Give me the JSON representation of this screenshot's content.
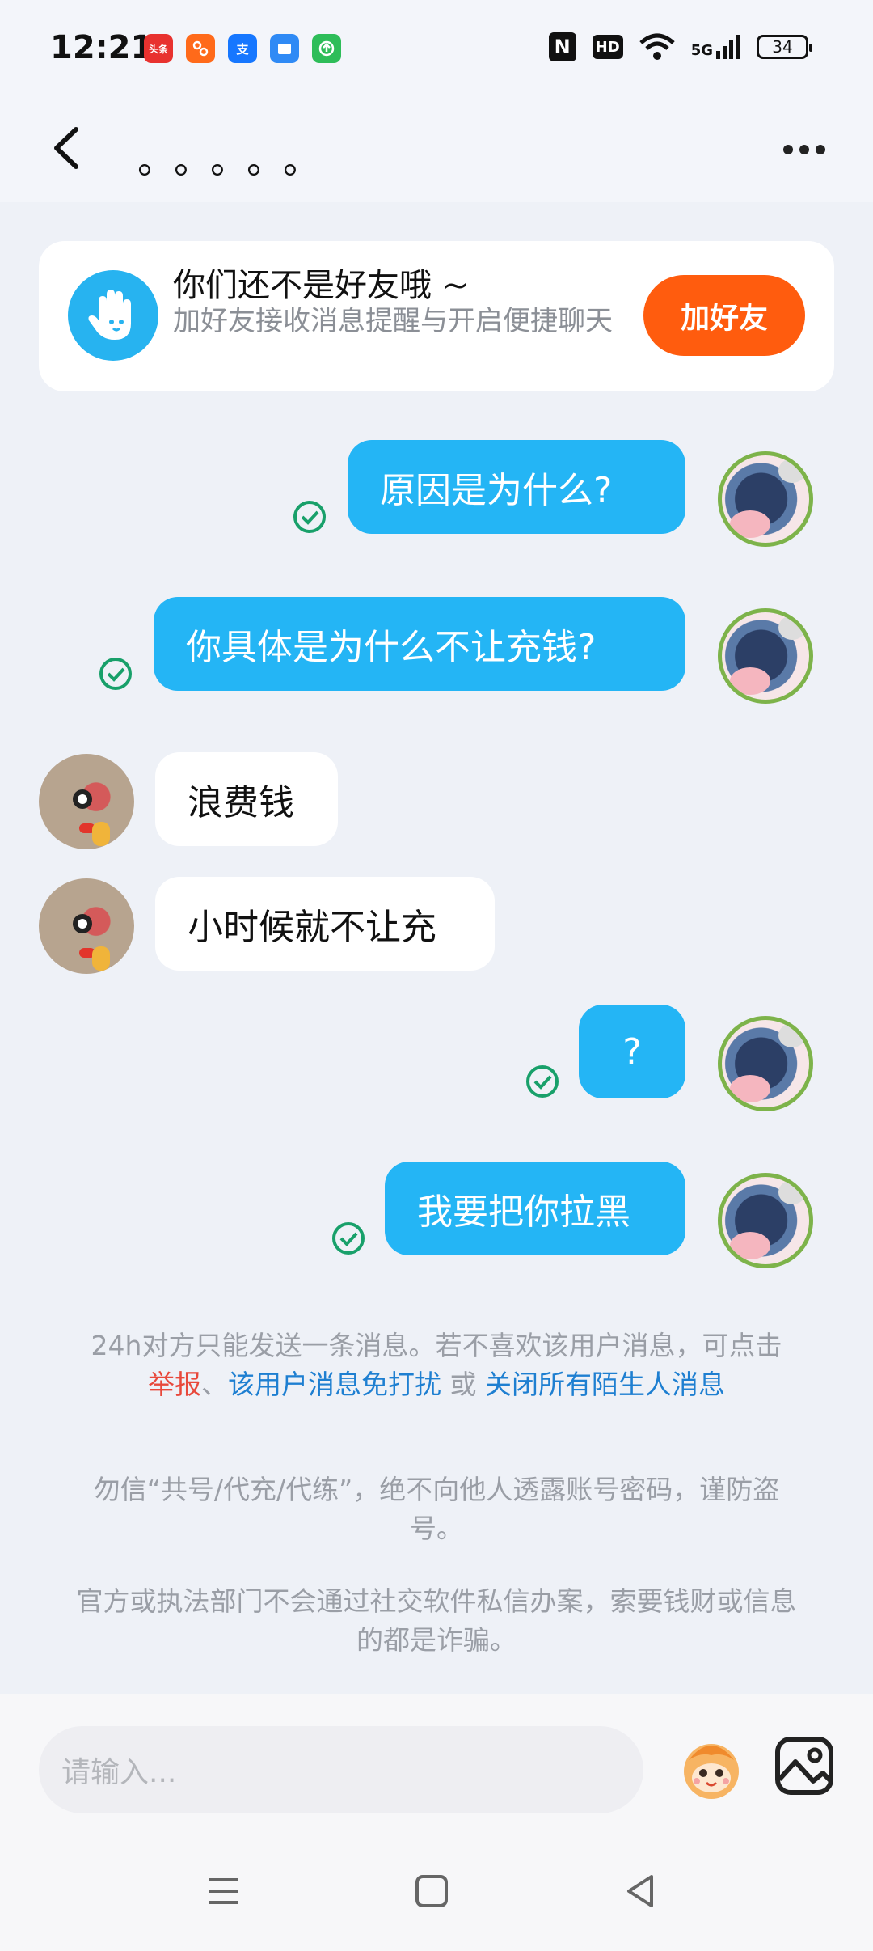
{
  "status_bar": {
    "time": "12:21",
    "apps": [
      {
        "name": "toutiao-icon",
        "label": "头条",
        "color": "#e8322f"
      },
      {
        "name": "app-orange-icon",
        "label": "",
        "color": "#ff6a1a"
      },
      {
        "name": "alipay-icon",
        "label": "支",
        "color": "#1677ff"
      },
      {
        "name": "files-icon",
        "label": "",
        "color": "#2f8af5"
      },
      {
        "name": "update-icon",
        "label": "",
        "color": "#2ebd59"
      }
    ],
    "nfc": "N",
    "hd": "HD",
    "network": "5G",
    "battery": "34"
  },
  "header": {
    "title": "。。。。。"
  },
  "friend_card": {
    "title": "你们还不是好友哦 ~",
    "subtitle": "加好友接收消息提醒与开启便捷聊天",
    "button": "加好友"
  },
  "messages": [
    {
      "from": "me",
      "text": "原因是为什么?"
    },
    {
      "from": "me",
      "text": "你具体是为什么不让充钱?"
    },
    {
      "from": "them",
      "text": "浪费钱"
    },
    {
      "from": "them",
      "text": "小时候就不让充"
    },
    {
      "from": "me",
      "text": "?"
    },
    {
      "from": "me",
      "text": "我要把你拉黑"
    }
  ],
  "notices": {
    "limit_text": "24h对方只能发送一条消息。若不喜欢该用户消息，可点击",
    "report": "举报",
    "sep1": "、",
    "mute_user": "该用户消息免打扰",
    "or": " 或 ",
    "close_strangers": "关闭所有陌生人消息",
    "warning1": "勿信“共号/代充/代练”，绝不向他人透露账号密码，谨防盗号。",
    "warning2": "官方或执法部门不会通过社交软件私信办案，索要钱财或信息的都是诈骗。"
  },
  "input_bar": {
    "placeholder": "请输入..."
  }
}
